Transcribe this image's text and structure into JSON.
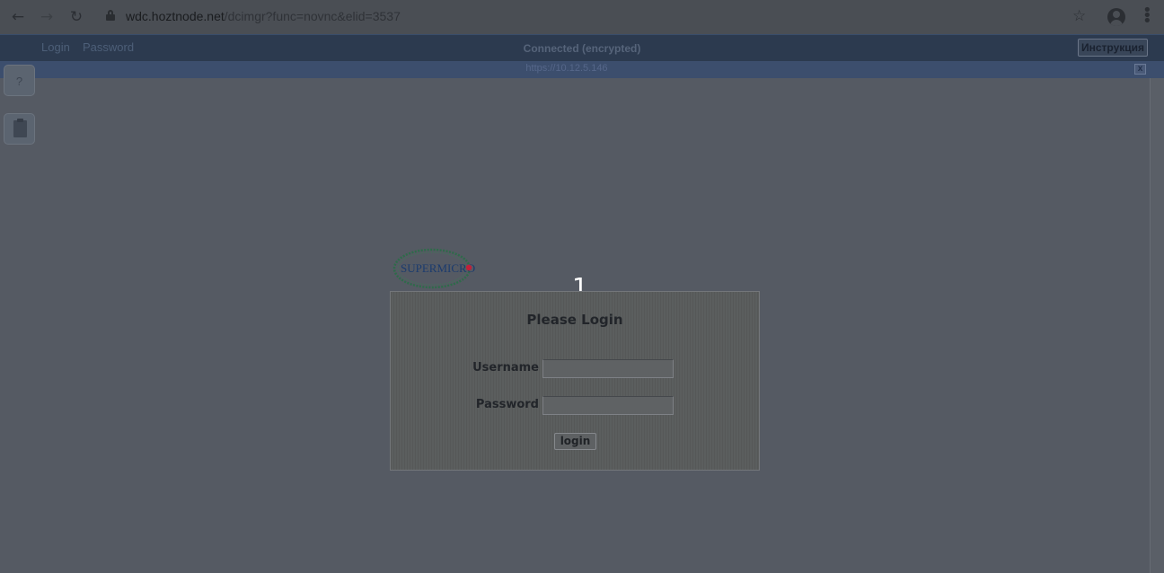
{
  "browser": {
    "url_domain": "wdc.hoztnode.net",
    "url_path": "/dcimgr?func=novnc&elid=3537",
    "icons": [
      "back-arrow-icon",
      "forward-arrow-icon",
      "reload-icon",
      "lock-icon",
      "star-icon",
      "account-icon",
      "menu-kebab-icon"
    ]
  },
  "app_header": {
    "login_label": "Login",
    "password_label": "Password",
    "status": "Connected (encrypted)",
    "instructions_label": "Инструкция"
  },
  "vnc_bar": {
    "address": "https://10.12.5.146",
    "close_label": "x"
  },
  "side_tools": {
    "help_label": "?",
    "icons": [
      "help-icon",
      "clipboard-icon"
    ]
  },
  "remote_screen": {
    "logo_text": "SUPERMICRO",
    "counter": "1",
    "login_panel": {
      "title": "Please Login",
      "username_label": "Username",
      "username_value": "",
      "password_label": "Password",
      "password_value": "",
      "login_button": "login"
    }
  },
  "colors": {
    "overlay_background": "#555a63",
    "header_background": "#2c3a4f",
    "vnc_bar_background": "#3c4e6d",
    "logo_green": "#2e6b4a",
    "logo_blue": "#1b3b6e",
    "logo_red": "#c0203a"
  }
}
